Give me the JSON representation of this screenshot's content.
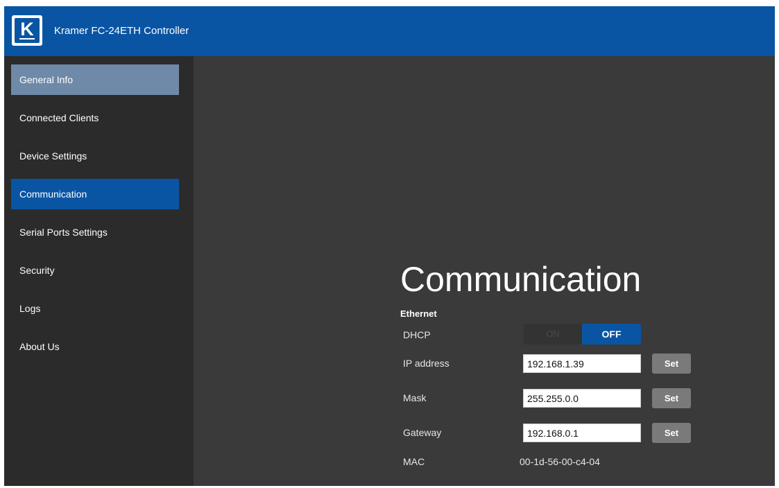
{
  "header": {
    "logo_letter": "K",
    "app_title": "Kramer FC-24ETH Controller"
  },
  "sidebar": {
    "items": [
      {
        "label": "General Info",
        "state": "hover"
      },
      {
        "label": "Connected Clients",
        "state": "normal"
      },
      {
        "label": "Device Settings",
        "state": "normal"
      },
      {
        "label": "Communication",
        "state": "active"
      },
      {
        "label": "Serial Ports Settings",
        "state": "normal"
      },
      {
        "label": "Security",
        "state": "normal"
      },
      {
        "label": "Logs",
        "state": "normal"
      },
      {
        "label": "About Us",
        "state": "normal"
      }
    ]
  },
  "main": {
    "title": "Communication",
    "section": "Ethernet",
    "dhcp": {
      "label": "DHCP",
      "on_label": "ON",
      "off_label": "OFF",
      "value": "OFF"
    },
    "ip": {
      "label": "IP address",
      "value": "192.168.1.39",
      "button": "Set"
    },
    "mask": {
      "label": "Mask",
      "value": "255.255.0.0",
      "button": "Set"
    },
    "gateway": {
      "label": "Gateway",
      "value": "192.168.0.1",
      "button": "Set"
    },
    "mac": {
      "label": "MAC",
      "value": "00-1d-56-00-c4-04"
    }
  },
  "colors": {
    "brand_blue": "#0a55a3",
    "sidebar_bg": "#2b2b2b",
    "content_bg": "#3a3a3a",
    "hover_item": "#6f8aa8",
    "button_grey": "#7a7a7a"
  },
  "icons": {
    "logo": "kramer-logo-icon"
  }
}
